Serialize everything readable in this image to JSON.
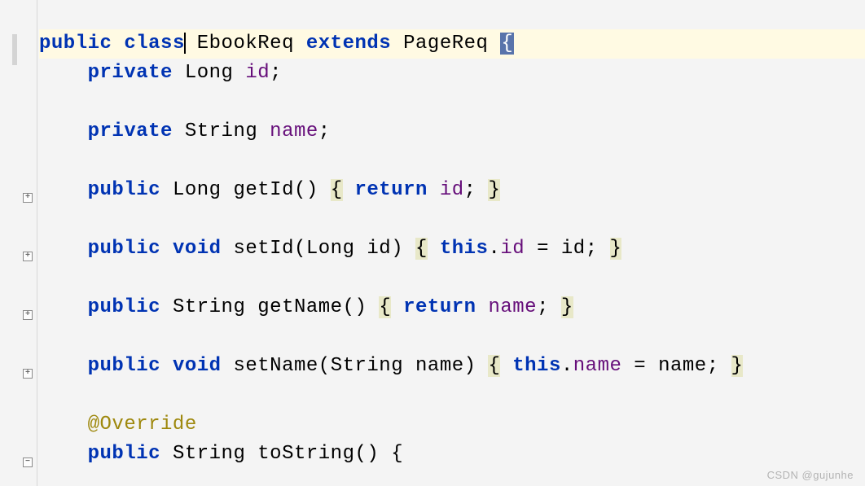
{
  "code": {
    "kw_public": "public",
    "kw_class": "class",
    "kw_extends": "extends",
    "kw_private": "private",
    "kw_void": "void",
    "kw_return": "return",
    "kw_this": "this",
    "type_long": "Long",
    "type_string": "String",
    "class_name": "EbookReq",
    "parent_class": "PageReq",
    "field_id": "id",
    "field_name": "name",
    "method_getId": "getId",
    "method_setId": "setId",
    "method_getName": "getName",
    "method_setName": "setName",
    "method_toString": "toString",
    "annotation_override": "@Override",
    "brace_open": "{",
    "brace_close": "}",
    "paren_open": "(",
    "paren_close": ")",
    "semicolon": ";",
    "dot": ".",
    "equals": "=",
    "space": " "
  },
  "watermark": {
    "text1": "CSDN @gujunhe",
    "text2": ""
  }
}
